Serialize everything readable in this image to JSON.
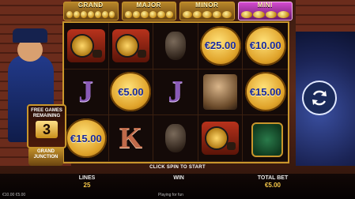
{
  "jackpots": [
    {
      "label": "GRAND"
    },
    {
      "label": "MAJOR"
    },
    {
      "label": "MINOR"
    },
    {
      "label": "MINI"
    }
  ],
  "reels": [
    [
      {
        "type": "train"
      },
      {
        "type": "train"
      },
      {
        "type": "vase"
      },
      {
        "type": "coin",
        "value": "€25.00"
      },
      {
        "type": "coin",
        "value": "€10.00"
      }
    ],
    [
      {
        "type": "letter",
        "value": "J"
      },
      {
        "type": "coin",
        "value": "€5.00"
      },
      {
        "type": "letter",
        "value": "J"
      },
      {
        "type": "lady"
      },
      {
        "type": "coin",
        "value": "€15.00"
      }
    ],
    [
      {
        "type": "coin",
        "value": "€15.00"
      },
      {
        "type": "letter",
        "value": "K"
      },
      {
        "type": "vase"
      },
      {
        "type": "train"
      },
      {
        "type": "badge"
      }
    ]
  ],
  "free_games": {
    "title": "FREE GAMES REMAINING",
    "count": "3"
  },
  "logo": {
    "text": "GRAND JUNCTION"
  },
  "message": "CLICK SPIN TO START",
  "bottom_bar": {
    "lines_label": "LINES",
    "lines_value": "25",
    "win_label": "WIN",
    "win_value": "",
    "total_bet_label": "TOTAL BET",
    "total_bet_value": "€5.00"
  },
  "footer": {
    "left": "€10.00 €5.00",
    "center": "Playing for fun"
  },
  "colors": {
    "accent_gold": "#c9962c",
    "coin_value_blue": "#1a2a9a",
    "jackpot_mini": "#d44bd0"
  },
  "icons": {
    "spin": "refresh-arrows-icon"
  }
}
